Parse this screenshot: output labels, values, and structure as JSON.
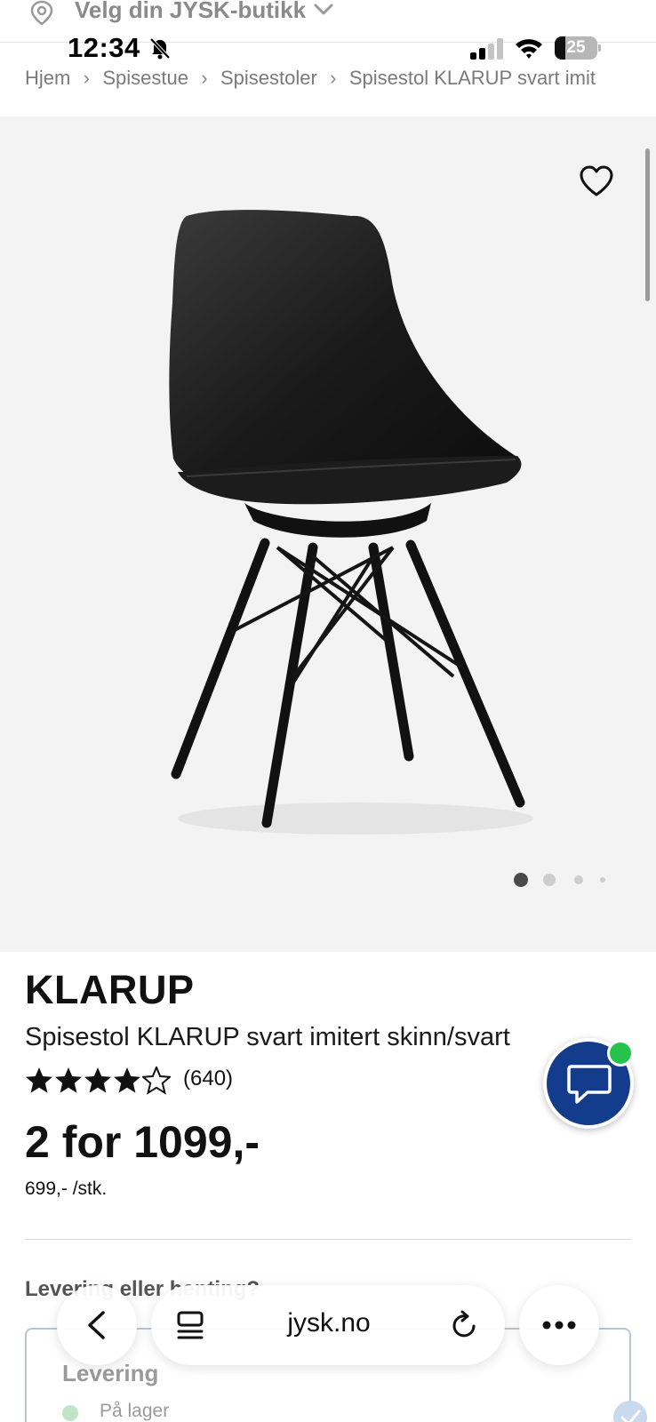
{
  "store_selector": {
    "label": "Velg din JYSK-butikk"
  },
  "status_bar": {
    "time": "12:34",
    "battery": "25",
    "battery_level": 0.25
  },
  "breadcrumb": {
    "items": [
      "Hjem",
      "Spisestue",
      "Spisestoler",
      "Spisestol KLARUP svart imit"
    ],
    "separator": "›"
  },
  "gallery": {
    "image_count": 4,
    "active_index": 0
  },
  "product": {
    "brand": "KLARUP",
    "name": "Spisestol KLARUP svart imitert skinn/svart",
    "rating": 4.5,
    "review_count": "(640)",
    "price": "2 for 1099,-",
    "unit_price": "699,- /stk."
  },
  "delivery": {
    "question": "Levering eller henting?",
    "option_title": "Levering",
    "stock_status": "På lager"
  },
  "browser": {
    "url": "jysk.no"
  },
  "icons": {
    "location": "location-pin-icon",
    "store_chevron": "chevron-down-icon",
    "favorite": "heart-icon",
    "chat": "chat-bubble-icon",
    "back": "back-arrow-icon",
    "tabs": "tabs-icon",
    "reload": "reload-icon",
    "more": "more-icon"
  },
  "colors": {
    "chat_bg": "#143c8c",
    "online_dot": "#27c24c"
  }
}
